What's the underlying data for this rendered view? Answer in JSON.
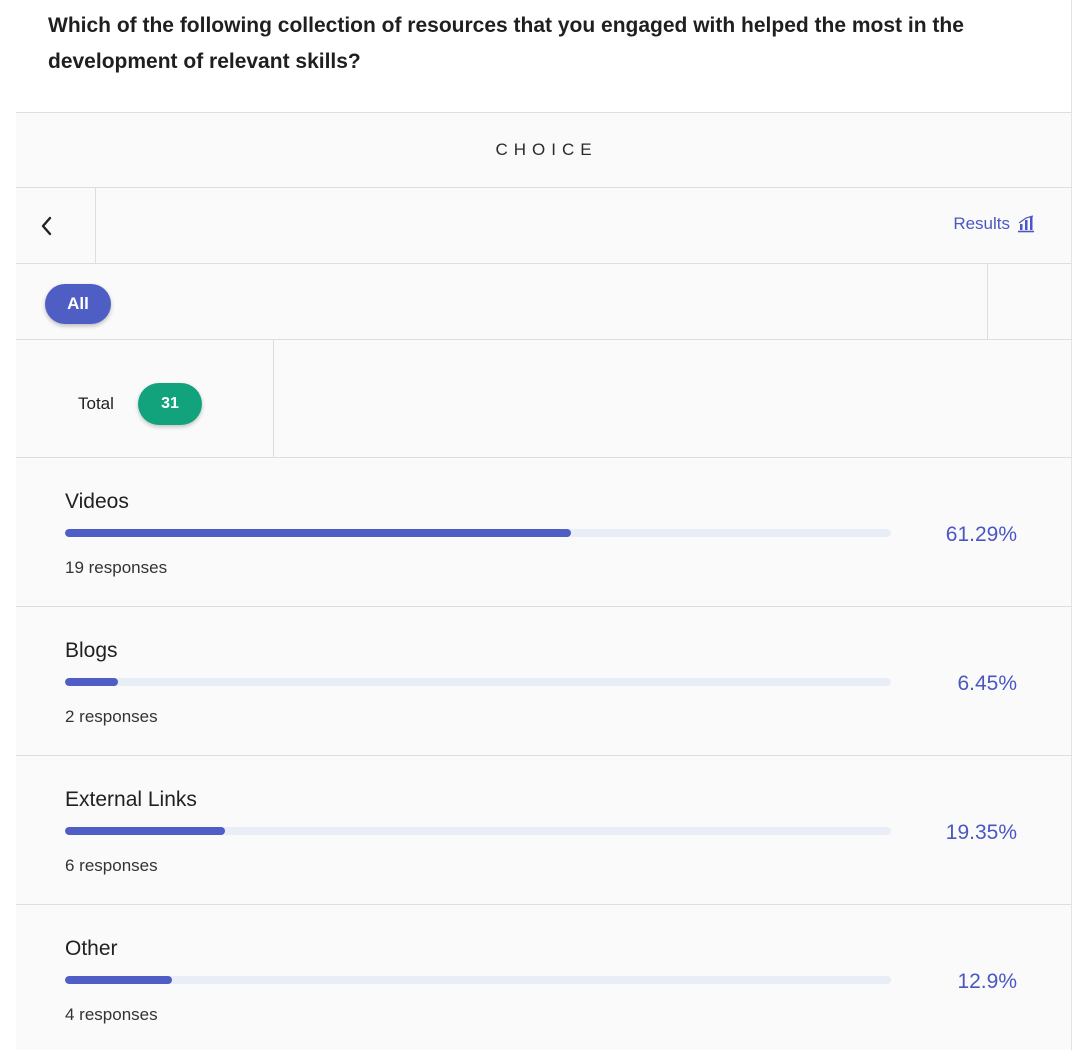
{
  "question": {
    "text": "Which of the following collection of resources that you engaged with helped the most in the development of relevant skills?"
  },
  "header": {
    "title": "CHOICE"
  },
  "nav": {
    "results_label": "Results"
  },
  "filters": {
    "chips": [
      {
        "label": "All",
        "selected": true
      }
    ]
  },
  "summary": {
    "total_label": "Total",
    "total_value": "31"
  },
  "options": [
    {
      "label": "Videos",
      "percent_text": "61.29%",
      "percent": 61.29,
      "responses": "19 responses"
    },
    {
      "label": "Blogs",
      "percent_text": "6.45%",
      "percent": 6.45,
      "responses": "2 responses"
    },
    {
      "label": "External Links",
      "percent_text": "19.35%",
      "percent": 19.35,
      "responses": "6 responses"
    },
    {
      "label": "Other",
      "percent_text": "12.9%",
      "percent": 12.9,
      "responses": "4 responses"
    }
  ],
  "colors": {
    "accent": "#4e5ec4",
    "badge": "#12a37d",
    "track": "#e9edf6"
  },
  "icons": {
    "back": "chevron-left-icon",
    "results": "bar-chart-icon"
  }
}
